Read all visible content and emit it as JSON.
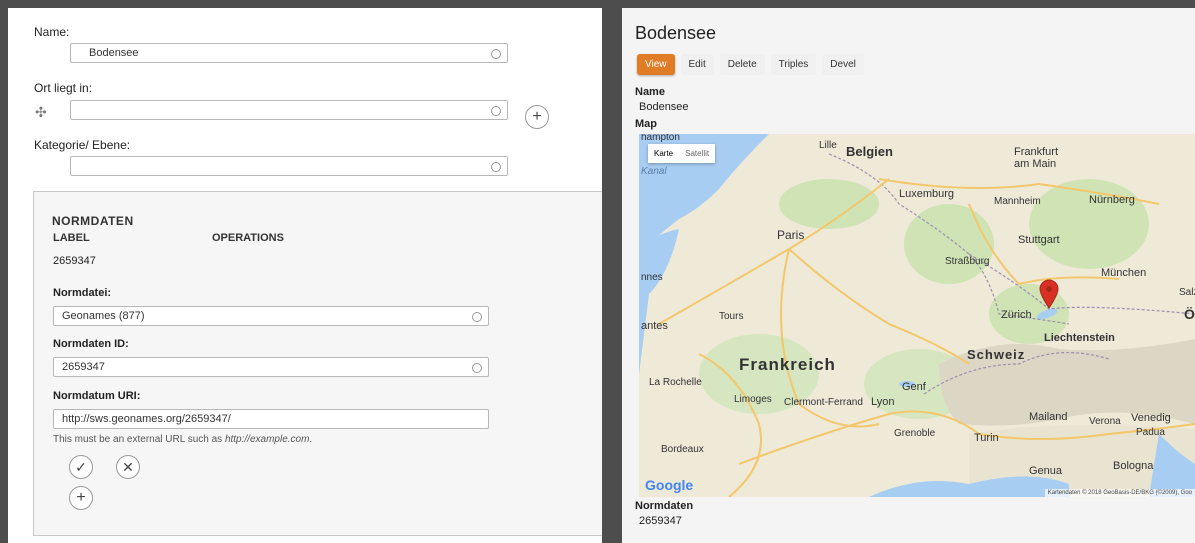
{
  "form": {
    "name_label": "Name:",
    "name_value": "Bodensee",
    "ort_label": "Ort liegt in:",
    "ort_value": "",
    "kategorie_label": "Kategorie/ Ebene:",
    "kategorie_value": "",
    "normdaten": {
      "title": "NORMDATEN",
      "col_label": "LABEL",
      "col_operations": "OPERATIONS",
      "row_value": "2659347",
      "normdatei_label": "Normdatei:",
      "normdatei_value": "Geonames (877)",
      "id_label": "Normdaten ID:",
      "id_value": "2659347",
      "uri_label": "Normdatum URI:",
      "uri_value": "http://sws.geonames.org/2659347/",
      "uri_help_prefix": "This must be an external URL such as ",
      "uri_help_example": "http://example.com",
      "uri_help_suffix": "."
    }
  },
  "view": {
    "title": "Bodensee",
    "tabs": [
      "View",
      "Edit",
      "Delete",
      "Triples",
      "Devel"
    ],
    "name_label": "Name",
    "name_value": "Bodensee",
    "map_label": "Map",
    "map_types": [
      "Karte",
      "Satellit"
    ],
    "normdaten_label": "Normdaten",
    "normdaten_value": "2659347",
    "map_labels": {
      "belgien": "Belgien",
      "frankfurt": "Frankfurt\nam Main",
      "luxemburg": "Luxemburg",
      "mannheim": "Mannheim",
      "nurnberg": "Nürnberg",
      "paris": "Paris",
      "stuttgart": "Stuttgart",
      "strassburg": "Straßburg",
      "munchen": "München",
      "salzburg": "Salzbu",
      "tours": "Tours",
      "nantes": "antes",
      "rennes": "nnes",
      "zurich": "Zürich",
      "liechtenstein": "Liechtenstein",
      "frankreich": "Frankreich",
      "schweiz": "Schweiz",
      "rochelle": "La Rochelle",
      "genf": "Genf",
      "limoges": "Limoges",
      "clermont": "Clermont-Ferrand",
      "lyon": "Lyon",
      "mailand": "Mailand",
      "verona": "Verona",
      "venedig": "Venedig",
      "padua": "Padua",
      "grenoble": "Grenoble",
      "turin": "Turin",
      "bordeaux": "Bordeaux",
      "genua": "Genua",
      "bologna": "Bologna",
      "lille": "Lille",
      "southampton": "hampton",
      "kanal": "Kanal",
      "osterreich": "Ö"
    },
    "google_logo": "Google",
    "attribution": "Kartendaten © 2018 GeoBasis-DE/BKG (©2009), Goo"
  },
  "colors": {
    "accent": "#e07b26",
    "marker": "#d93025",
    "water": "#a8cdf2",
    "land": "#efe9d8",
    "forest": "#cfe3b4",
    "roads": "#f3c76b"
  }
}
